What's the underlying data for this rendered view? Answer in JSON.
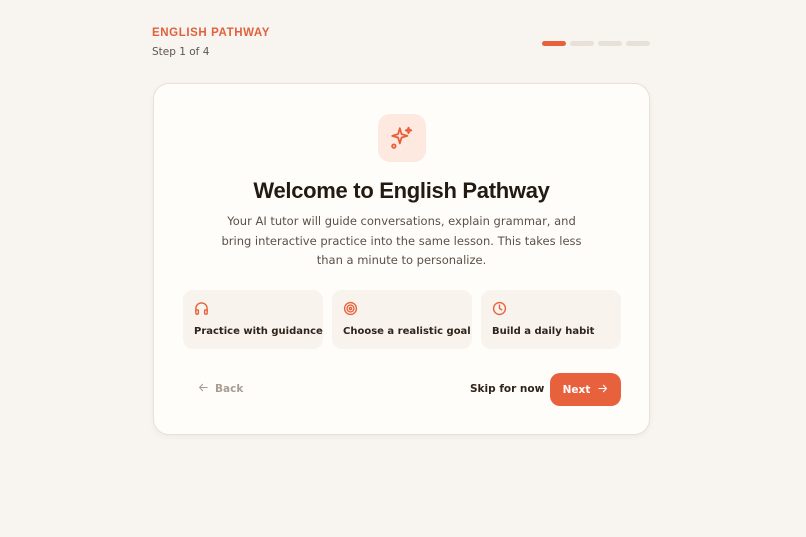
{
  "header": {
    "brand": "ENGLISH PATHWAY",
    "step_label": "Step 1 of 4",
    "progress": {
      "current": 1,
      "total": 4
    }
  },
  "card": {
    "hero_icon": "sparkles-icon",
    "title": "Welcome to English Pathway",
    "description": "Your AI tutor will guide conversations, explain grammar, and bring interactive practice into the same lesson. This takes less than a minute to personalize.",
    "features": [
      {
        "icon": "headphones-icon",
        "label": "Practice with guidance"
      },
      {
        "icon": "target-icon",
        "label": "Choose a realistic goal"
      },
      {
        "icon": "clock-icon",
        "label": "Build a daily habit"
      }
    ],
    "actions": {
      "back_label": "Back",
      "skip_label": "Skip for now",
      "next_label": "Next"
    }
  },
  "colors": {
    "accent": "#e8613d",
    "background": "#f8f5f1",
    "card": "#fffdf9",
    "inactive_segment": "#e7e1d9"
  }
}
